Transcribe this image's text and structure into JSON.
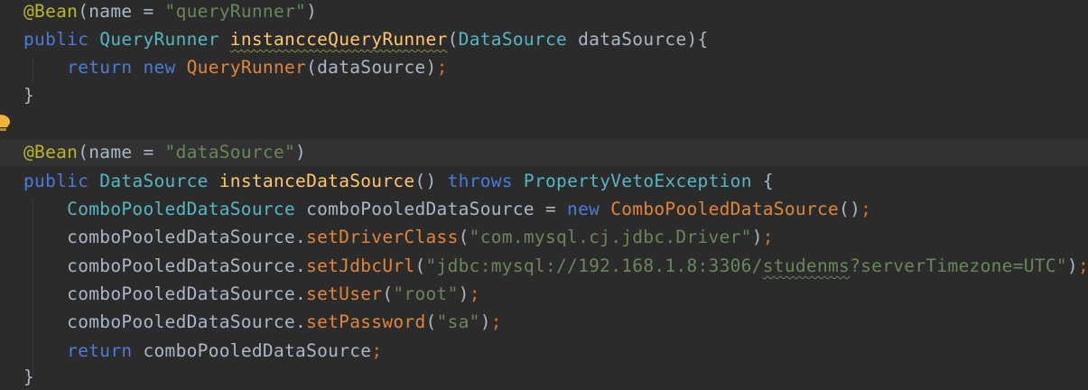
{
  "editor": {
    "language": "java",
    "theme_colors": {
      "background": "#2b2b2b",
      "current_line": "#323232",
      "annotation": "#bbb529",
      "keyword": "#4b7bd9",
      "type": "#4ec9b0",
      "method_decl": "#ffc66d",
      "method_call": "#e0863a",
      "string": "#6a8759",
      "default": "#a9b7c6"
    },
    "gutter_icon": "lightbulb-icon",
    "lines": [
      {
        "at": "@Bean",
        "open": "(",
        "param": "name",
        "eq": " = ",
        "val": "\"queryRunner\"",
        "close": ")"
      },
      {
        "mod": "public",
        "type": "QueryRunner",
        "name": "instancceQueryRunner",
        "open": "(",
        "ptype": "DataSource",
        "pname": "dataSource",
        "close": "){"
      },
      {
        "kw": "return",
        "kw2": "new",
        "ctor": "QueryRunner",
        "args": "(dataSource)",
        "semi": ";"
      },
      {
        "close": "}"
      },
      {
        "at": "@Bean",
        "open": "(",
        "param": "name",
        "eq": " = ",
        "val": "\"dataSource\"",
        "close": ")"
      },
      {
        "mod": "public",
        "type": "DataSource",
        "name": "instanceDataSource",
        "parens": "()",
        "throws": "throws",
        "exc": "PropertyVetoException",
        "brace": "{"
      },
      {
        "type": "ComboPooledDataSource",
        "var": "comboPooledDataSource",
        "eq": " = ",
        "kw": "new",
        "ctor": "ComboPooledDataSource",
        "args": "()",
        "semi": ";"
      },
      {
        "obj": "comboPooledDataSource.",
        "method": "setDriverClass",
        "open": "(",
        "str": "\"com.mysql.cj.jdbc.Driver\"",
        "close": ")",
        "semi": ";"
      },
      {
        "obj": "comboPooledDataSource.",
        "method": "setJdbcUrl",
        "open": "(",
        "str_a": "\"jdbc:mysql://192.168.1.8:3306/",
        "str_b": "studenms",
        "str_c": "?serverTimezone=UTC\"",
        "close": ")",
        "semi": ";"
      },
      {
        "obj": "comboPooledDataSource.",
        "method": "setUser",
        "open": "(",
        "str": "\"root\"",
        "close": ")",
        "semi": ";"
      },
      {
        "obj": "comboPooledDataSource.",
        "method": "setPassword",
        "open": "(",
        "str": "\"sa\"",
        "close": ")",
        "semi": ";"
      },
      {
        "kw": "return",
        "var": "comboPooledDataSource",
        "semi": ";"
      },
      {
        "close": "}"
      }
    ]
  }
}
